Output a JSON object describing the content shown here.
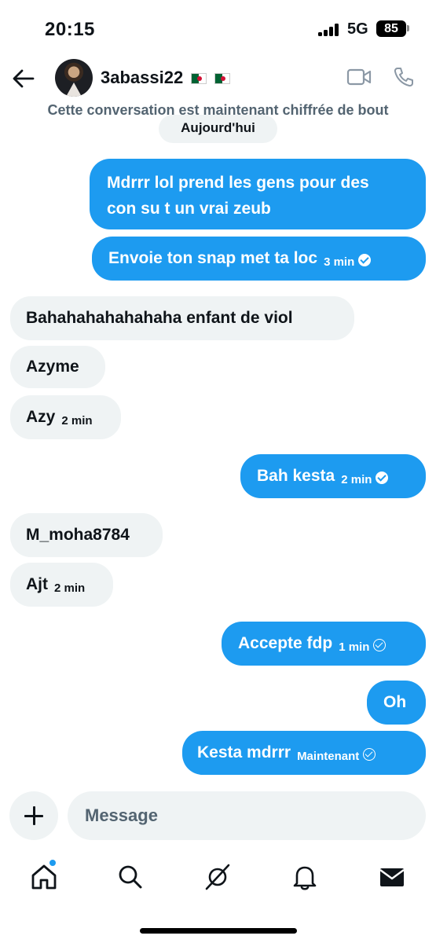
{
  "status_bar": {
    "time": "20:15",
    "network": "5G",
    "battery": "85"
  },
  "header": {
    "contact_name": "3abassi22",
    "back_icon": "arrow-left-icon",
    "video_icon": "video-camera-icon",
    "call_icon": "phone-icon"
  },
  "conversation": {
    "encryption_notice": "Cette conversation est maintenant chiffrée de bout",
    "date_label": "Aujourd'hui",
    "messages": [
      {
        "direction": "out",
        "text": "Mdrrr lol prend les gens pour des",
        "text2": "con su t un vrai zeub",
        "time": ""
      },
      {
        "direction": "out",
        "text": "Envoie ton snap met ta loc",
        "time": "3 min",
        "status": "read"
      },
      {
        "direction": "in",
        "text": "Bahahahahahahaha enfant de viol",
        "time": ""
      },
      {
        "direction": "in",
        "text": "Azyme",
        "time": ""
      },
      {
        "direction": "in",
        "text": "Azy",
        "time": "2 min"
      },
      {
        "direction": "out",
        "text": "Bah kesta",
        "time": "2 min",
        "status": "read"
      },
      {
        "direction": "in",
        "text": "M_moha8784",
        "time": ""
      },
      {
        "direction": "in",
        "text": "Ajt",
        "time": "2 min"
      },
      {
        "direction": "out",
        "text": "Accepte fdp",
        "time": "1 min",
        "status": "sent"
      },
      {
        "direction": "out",
        "text": "Oh",
        "time": ""
      },
      {
        "direction": "out",
        "text": "Kesta mdrrr",
        "time": "Maintenant",
        "status": "sent"
      }
    ]
  },
  "composer": {
    "placeholder": "Message",
    "value": "",
    "plus_icon": "plus-icon"
  },
  "bottom_nav": {
    "items": [
      "home-icon",
      "search-icon",
      "grok-icon",
      "notifications-bell-icon",
      "messages-envelope-icon"
    ],
    "active": "home-icon"
  },
  "colors": {
    "accent": "#1d9bf0",
    "incoming_bubble": "#eff3f4",
    "text": "#0f1419",
    "muted": "#536471"
  }
}
